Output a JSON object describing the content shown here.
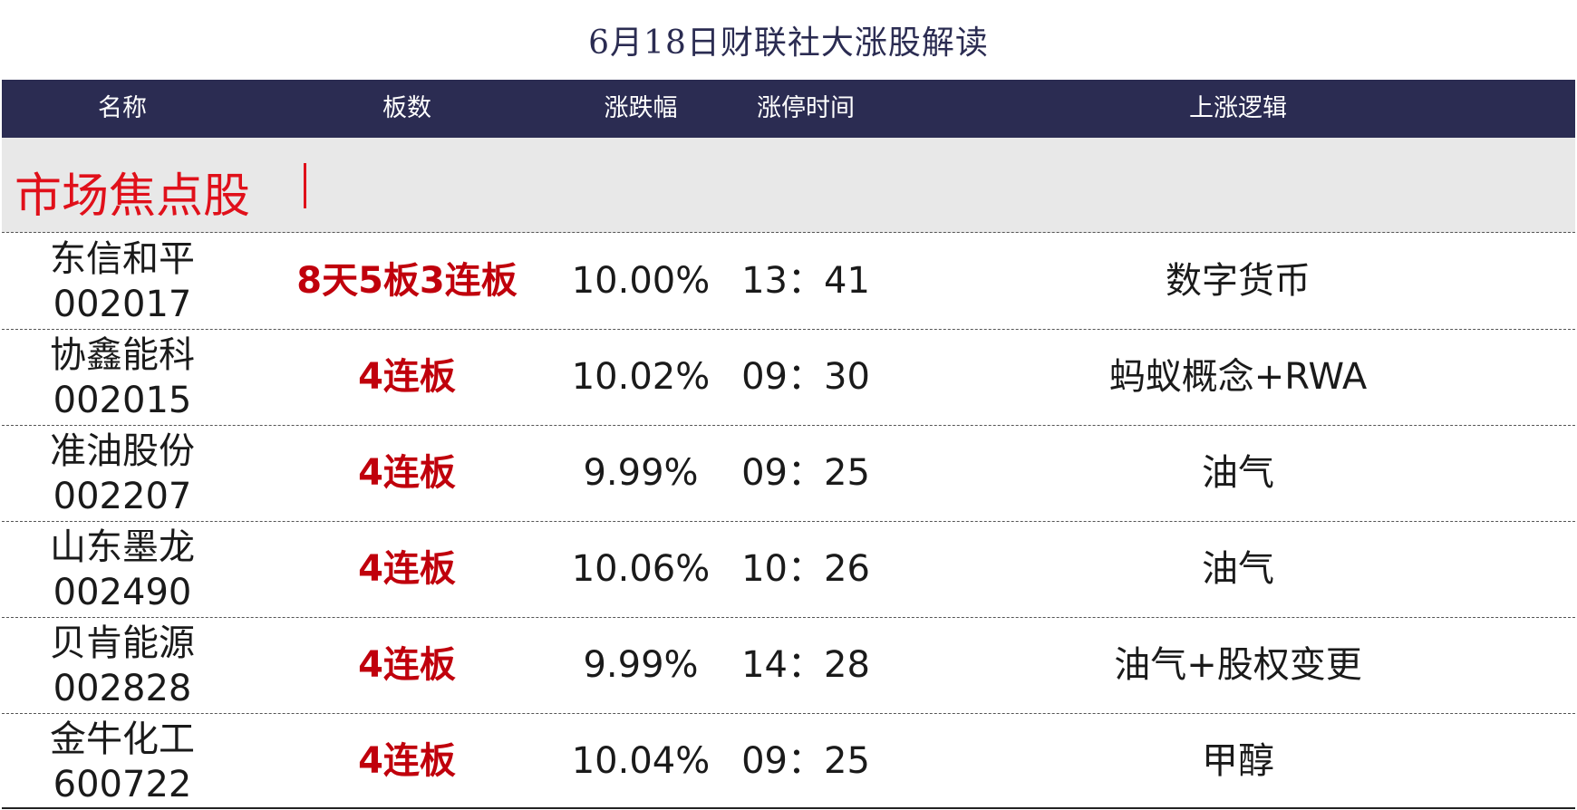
{
  "title": "6月18日财联社大涨股解读",
  "headers": [
    "名称",
    "板数",
    "涨跌幅",
    "涨停时间",
    "上涨逻辑"
  ],
  "section_label": "市场焦点股",
  "rows": [
    {
      "name": "东信和平",
      "code": "002017",
      "boards": "8天5板3连板",
      "pct": "10.00%",
      "time": "13：41",
      "logic": "数字货币"
    },
    {
      "name": "协鑫能科",
      "code": "002015",
      "boards": "4连板",
      "pct": "10.02%",
      "time": "09：30",
      "logic": "蚂蚁概念+RWA"
    },
    {
      "name": "准油股份",
      "code": "002207",
      "boards": "4连板",
      "pct": "9.99%",
      "time": "09：25",
      "logic": "油气"
    },
    {
      "name": "山东墨龙",
      "code": "002490",
      "boards": "4连板",
      "pct": "10.06%",
      "time": "10：26",
      "logic": "油气"
    },
    {
      "name": "贝肯能源",
      "code": "002828",
      "boards": "4连板",
      "pct": "9.99%",
      "time": "14：28",
      "logic": "油气+股权变更"
    },
    {
      "name": "金牛化工",
      "code": "600722",
      "boards": "4连板",
      "pct": "10.04%",
      "time": "09：25",
      "logic": "甲醇"
    }
  ],
  "colors": {
    "header_bg": "#2b2c52",
    "accent_red": "#c0000c",
    "section_bg": "#e8e8e8"
  }
}
